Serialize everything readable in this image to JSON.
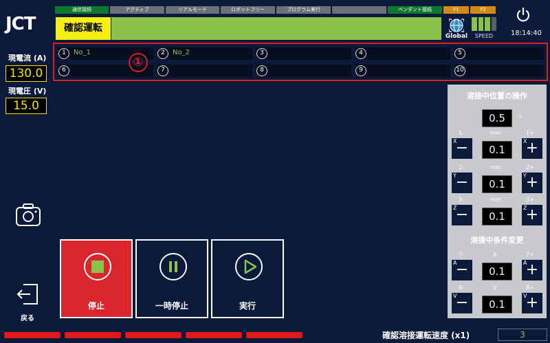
{
  "header": {
    "logo": "JCT",
    "status_pills": [
      {
        "label": "通信接続",
        "color": "#0c7a2e"
      },
      {
        "label": "アクティブ",
        "color": "#6b6f78"
      },
      {
        "label": "リアルモード",
        "color": "#6b6f78"
      },
      {
        "label": "ロボットフリー",
        "color": "#6b6f78"
      },
      {
        "label": "プログラム実行",
        "color": "#6b6f78"
      },
      {
        "label": "",
        "color": "#6b6f78"
      },
      {
        "label": "ペンダント接続",
        "color": "#0c7a2e"
      },
      {
        "label": "F1",
        "color": "#d48a12"
      },
      {
        "label": "F2",
        "color": "#d48a12"
      }
    ],
    "mode_label": "確認運転",
    "global_label": "Global",
    "speed_label": "SPEED",
    "time": "18:14:40"
  },
  "left": {
    "current_label": "現電流 (A)",
    "current_value": "130.0",
    "voltage_label": "現電圧 (V)",
    "voltage_value": "15.0",
    "back_label": "戻る"
  },
  "slots": [
    {
      "num": "1",
      "name": "No_1"
    },
    {
      "num": "2",
      "name": "No_2"
    },
    {
      "num": "3",
      "name": ""
    },
    {
      "num": "4",
      "name": ""
    },
    {
      "num": "5",
      "name": ""
    },
    {
      "num": "6",
      "name": ""
    },
    {
      "num": "7",
      "name": ""
    },
    {
      "num": "8",
      "name": ""
    },
    {
      "num": "9",
      "name": ""
    },
    {
      "num": "10",
      "name": ""
    }
  ],
  "annotation_marker": "①",
  "op_panel": {
    "title": "溶接中位置の操作",
    "time_value": "0.5",
    "time_unit": "s",
    "x": {
      "minus_label": "1-",
      "plus_label": "1+",
      "unit": "mm",
      "value": "0.1",
      "axis": "X"
    },
    "y": {
      "minus_label": "2-",
      "plus_label": "2+",
      "unit": "mm",
      "value": "0.1",
      "axis": "Y"
    },
    "z": {
      "minus_label": "3-",
      "plus_label": "3+",
      "unit": "mm",
      "value": "0.1",
      "axis": "Z"
    },
    "cond_title": "溶接中条件変更",
    "a": {
      "minus_label": "7-",
      "plus_label": "7+",
      "unit": "A",
      "value": "0.1",
      "axis": "A"
    },
    "v": {
      "minus_label": "8-",
      "plus_label": "8+",
      "unit": "V",
      "value": "0.1",
      "axis": "V"
    }
  },
  "controls": {
    "stop_label": "停止",
    "pause_label": "一時停止",
    "run_label": "実行"
  },
  "footer": {
    "speed_text": "確認溶接運転速度 (x1)",
    "speed_value": "3"
  },
  "colors": {
    "background": "#0b1a3a",
    "accent_green": "#8bc34a",
    "stop_red": "#d9252b",
    "highlight_yellow": "#f5ef16"
  }
}
